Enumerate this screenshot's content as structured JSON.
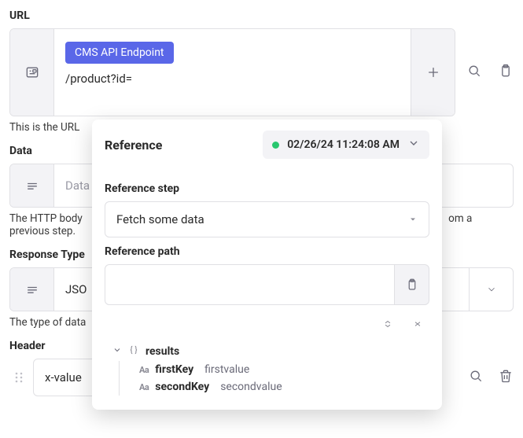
{
  "url": {
    "label": "URL",
    "chip": "CMS API Endpoint",
    "path": "/product?id=",
    "helper": "This is the URL "
  },
  "data": {
    "label": "Data",
    "placeholder": "Data",
    "helper_prefix": "The HTTP body ",
    "helper_suffix": "om a previous step."
  },
  "response": {
    "label": "Response Type",
    "value": "JSO",
    "helper": "The type of data"
  },
  "header": {
    "label": "Header",
    "key": "x-value"
  },
  "popover": {
    "title": "Reference",
    "timestamp": "02/26/24 11:24:08 AM",
    "step_label": "Reference step",
    "step_value": "Fetch some data",
    "path_label": "Reference path",
    "tree": {
      "root": "results",
      "items": [
        {
          "key": "firstKey",
          "value": "firstvalue"
        },
        {
          "key": "secondKey",
          "value": "secondvalue"
        }
      ]
    }
  }
}
